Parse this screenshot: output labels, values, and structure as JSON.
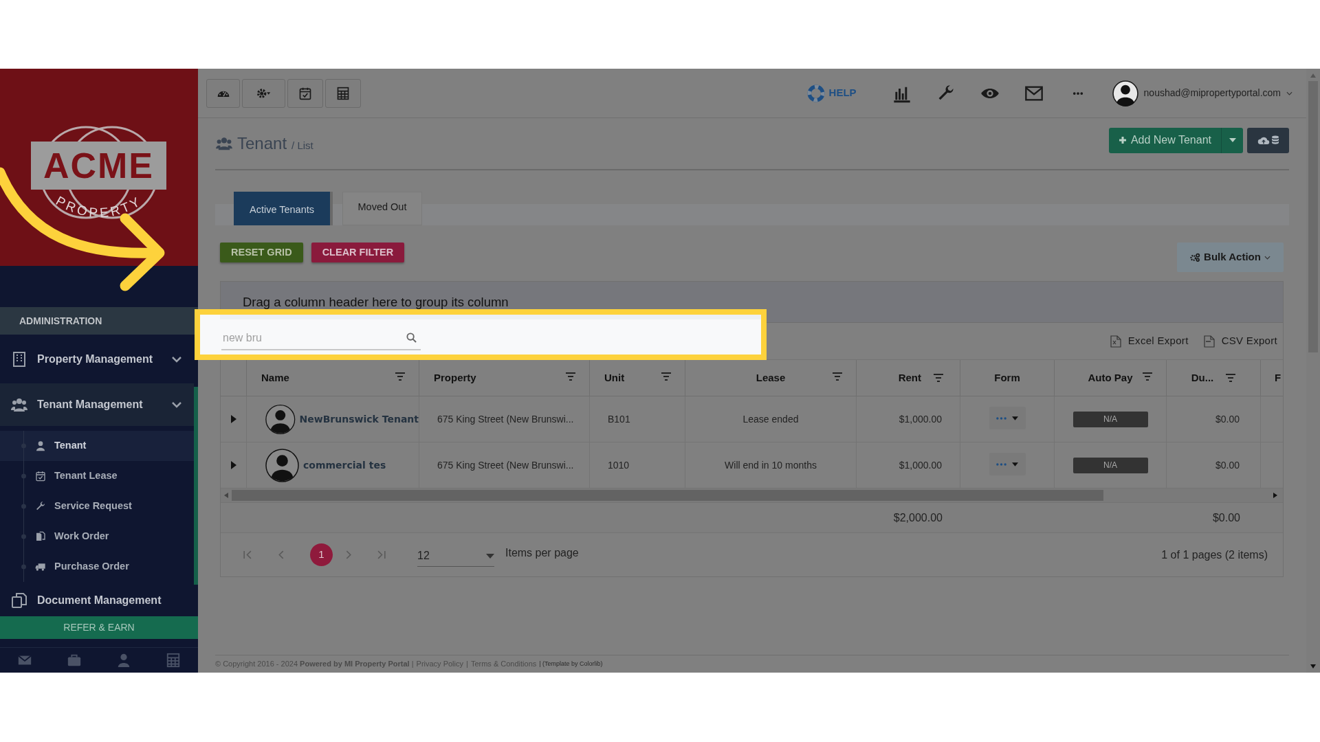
{
  "logo": {
    "name": "ACME",
    "tagline": "PROPERTY"
  },
  "sidebar": {
    "section": "ADMINISTRATION",
    "menu": [
      {
        "label": "Property Management",
        "expanded": false
      },
      {
        "label": "Tenant Management",
        "expanded": true,
        "children": [
          {
            "label": "Tenant",
            "selected": true
          },
          {
            "label": "Tenant Lease",
            "selected": false
          },
          {
            "label": "Service Request",
            "selected": false
          },
          {
            "label": "Work Order",
            "selected": false
          },
          {
            "label": "Purchase Order",
            "selected": false
          }
        ]
      },
      {
        "label": "Document Management",
        "expanded": false
      }
    ],
    "refer": "REFER & EARN"
  },
  "header": {
    "help": "HELP",
    "user_email": "noushad@mipropertyportal.com"
  },
  "page": {
    "title": "Tenant",
    "crumb": "/ List",
    "add_button": "Add New Tenant"
  },
  "tabs": [
    {
      "label": "Active Tenants",
      "selected": true
    },
    {
      "label": "Moved Out",
      "selected": false
    }
  ],
  "grid_buttons": [
    {
      "label": "RESET GRID",
      "kind": "reset"
    },
    {
      "label": "CLEAR FILTER",
      "kind": "clear"
    }
  ],
  "bulk_action": "Bulk Action",
  "grid": {
    "group_hint": "Drag a column header here to group its column",
    "search": {
      "value": "new bru"
    },
    "exports": [
      "Excel Export",
      "CSV Export"
    ],
    "columns": [
      {
        "label": "Name",
        "filter": true
      },
      {
        "label": "Property",
        "filter": true
      },
      {
        "label": "Unit",
        "filter": true
      },
      {
        "label": "Lease",
        "filter": true
      },
      {
        "label": "Rent",
        "filter": true
      },
      {
        "label": "Form",
        "filter": false
      },
      {
        "label": "Auto Pay",
        "filter": true
      },
      {
        "label": "Du...",
        "filter": true
      },
      {
        "label": "F",
        "filter": false
      }
    ],
    "rows": [
      {
        "name": "NewBrunswick Tenant",
        "property": "675 King Street (New Brunswi...",
        "unit": "B101",
        "lease": "Lease ended",
        "rent": "$1,000.00",
        "auto_pay": "N/A",
        "due": "$0.00"
      },
      {
        "name": "commercial tes",
        "property": "675 King Street (New Brunswi...",
        "unit": "1010",
        "lease": "Will end in 10 months",
        "rent": "$1,000.00",
        "auto_pay": "N/A",
        "due": "$0.00"
      }
    ],
    "totals": {
      "rent": "$2,000.00",
      "due": "$0.00"
    },
    "pager": {
      "pages": [
        {
          "label": "1",
          "selected": true
        }
      ],
      "page_size": "12",
      "page_size_label": "Items per page",
      "summary": "1 of 1 pages (2 items)"
    }
  },
  "footer": {
    "copyright": "© Copyright 2016 - 2024 **Powered by MI Property Portal** |",
    "links": [
      "Privacy Policy",
      "Terms & Conditions"
    ],
    "separator": "|",
    "credit": "| (Template by Colorlib)"
  }
}
